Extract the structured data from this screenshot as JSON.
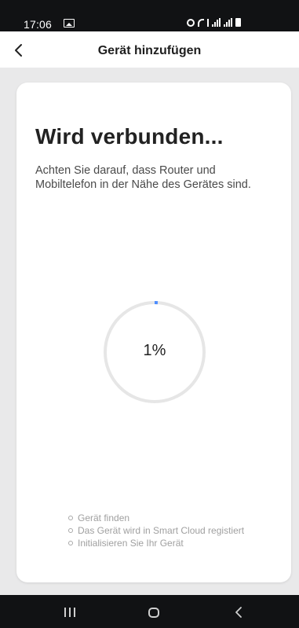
{
  "status_bar": {
    "time": "17:06"
  },
  "header": {
    "title": "Gerät hinzufügen"
  },
  "card": {
    "title": "Wird verbunden...",
    "description": "Achten Sie darauf, dass Router und Mobiltelefon in der Nähe des Gerätes sind."
  },
  "progress": {
    "percent_label": "1%",
    "fraction": 0.01,
    "track_color": "#e6e6e6",
    "accent_color": "#4d8dff"
  },
  "steps": [
    {
      "label": "Gerät finden"
    },
    {
      "label": "Das Gerät wird in Smart Cloud registiert"
    },
    {
      "label": "Initialisieren Sie Ihr Gerät"
    }
  ],
  "icons": {
    "back": "chevron-left-icon",
    "status": [
      "image-icon",
      "alarm-icon",
      "wifi-icon",
      "signal-icon",
      "signal-icon",
      "battery-icon"
    ],
    "nav": [
      "recent-apps-icon",
      "home-icon",
      "back-icon"
    ]
  }
}
